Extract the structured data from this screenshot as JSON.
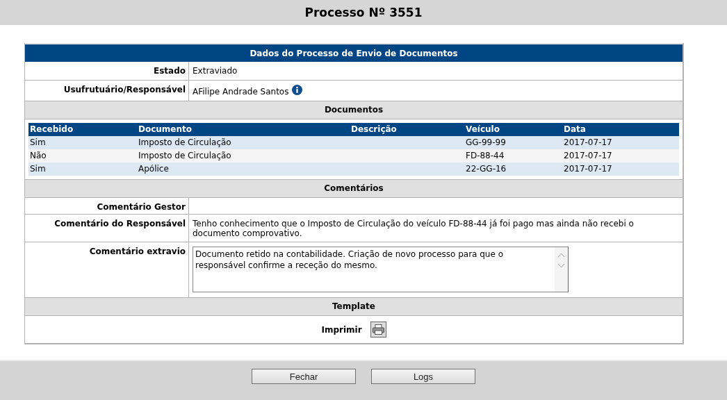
{
  "page_title": "Processo Nº 3551",
  "panel": {
    "title": "Dados do Processo de Envio de Documentos",
    "fields": [
      {
        "label": "Estado",
        "value": "Extraviado"
      },
      {
        "label": "Usufrutuário/Responsável",
        "value": "AFilipe Andrade Santos",
        "info": true
      }
    ]
  },
  "documents": {
    "title": "Documentos",
    "columns": [
      "Recebido",
      "Documento",
      "Descrição",
      "Veículo",
      "Data"
    ],
    "rows": [
      {
        "received": "Sim",
        "document": "Imposto de Circulação",
        "vehicle": "GG-99-99",
        "date": "2017-07-17"
      },
      {
        "received": "Não",
        "document": "Imposto de Circulação",
        "vehicle": "FD-88-44",
        "date": "2017-07-17"
      },
      {
        "received": "Sim",
        "document": "Apólice",
        "vehicle": "22-GG-16",
        "date": "2017-07-17"
      }
    ]
  },
  "comments": {
    "title": "Comentários",
    "fields": [
      {
        "label": "Comentário Gestor",
        "kind": "text"
      },
      {
        "label": "Comentário do Responsável",
        "kind": "text",
        "value": "Tenho conhecimento que o Imposto de Circulação do veículo FD-88-44 já foi pago mas ainda não recebi o documento comprovativo."
      },
      {
        "label": "Comentário extravio",
        "kind": "textarea",
        "value": "Documento retido na contabilidade. Criação de novo processo para que o responsável confirme a receção do mesmo."
      }
    ]
  },
  "template": {
    "title": "Template",
    "print_label": "Imprimir"
  },
  "buttons": [
    "Fechar",
    "Logs"
  ]
}
